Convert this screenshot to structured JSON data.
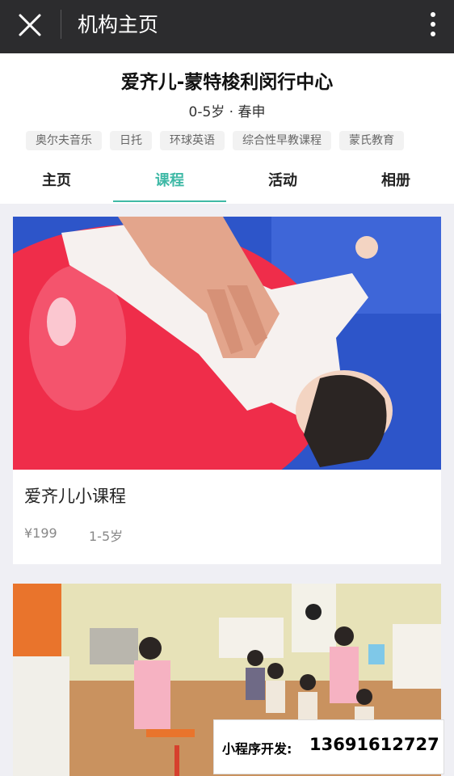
{
  "topbar": {
    "title": "机构主页",
    "close_icon": "close-icon",
    "more_icon": "more-vertical-icon"
  },
  "org": {
    "name": "爱齐儿-蒙特梭利闵行中心",
    "meta": "0-5岁 · 春申",
    "tags": [
      "奥尔夫音乐",
      "日托",
      "环球英语",
      "综合性早教课程",
      "蒙氏教育"
    ]
  },
  "tabs": {
    "items": [
      "主页",
      "课程",
      "活动",
      "相册"
    ],
    "active": "课程"
  },
  "courses": [
    {
      "title": "爱齐儿小课程",
      "price": "¥199",
      "age": "1-5岁"
    }
  ],
  "promo": {
    "label": "小程序开发:",
    "phone": "13691612727"
  },
  "colors": {
    "topbar": "#2c2c2e",
    "accent": "#3fb9a6",
    "background": "#efeff4"
  }
}
